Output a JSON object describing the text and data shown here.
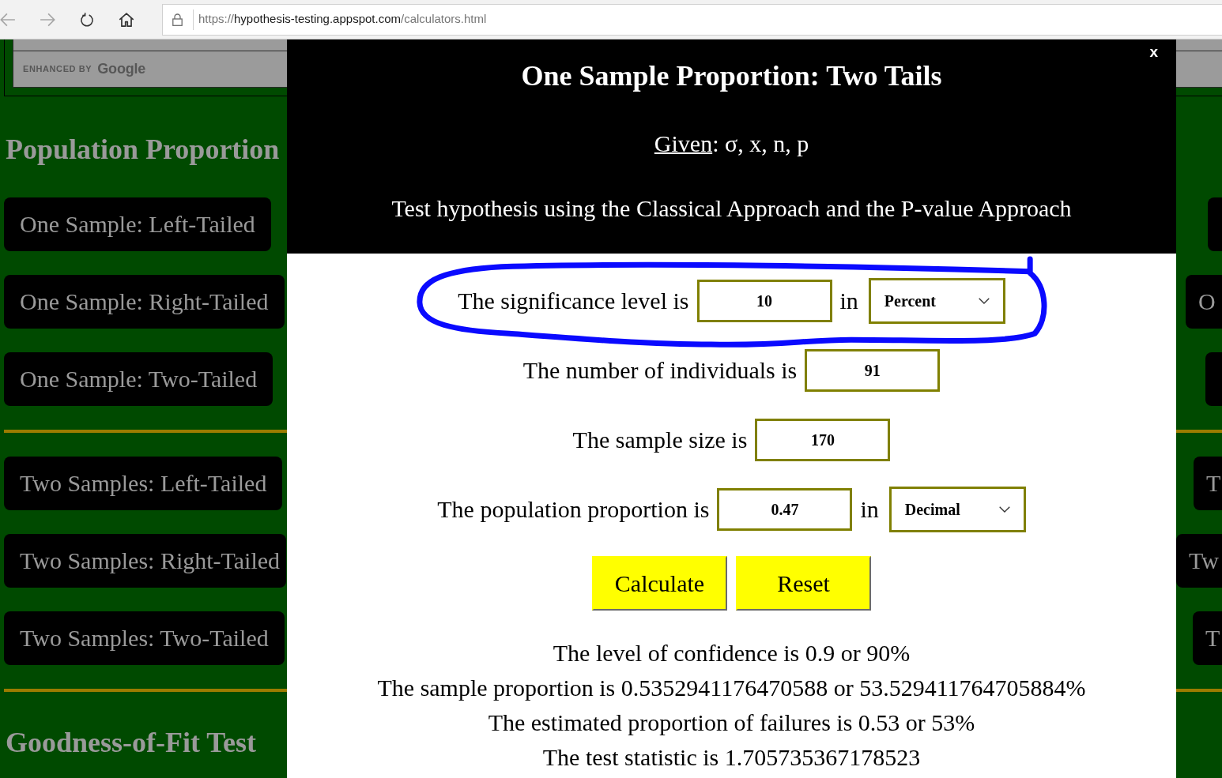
{
  "browser": {
    "nav_buttons": [
      {
        "kind": "back",
        "disabled": true
      },
      {
        "kind": "forward",
        "disabled": true
      },
      {
        "kind": "reload",
        "disabled": false
      },
      {
        "kind": "home",
        "disabled": false
      }
    ],
    "address": {
      "scheme": "https://",
      "host": "hypothesis-testing.appspot.com",
      "path": "/calculators.html"
    }
  },
  "search": {
    "branding_prefix": "ENHANCED BY",
    "branding_name": "Google"
  },
  "left_column": [
    {
      "kind": "heading",
      "text": "Population Proportion"
    },
    {
      "kind": "button",
      "label": "One Sample: Left-Tailed"
    },
    {
      "kind": "button",
      "label": "One Sample: Right-Tailed"
    },
    {
      "kind": "button",
      "label": "One Sample: Two-Tailed"
    },
    {
      "kind": "rule"
    },
    {
      "kind": "button",
      "label": "Two Samples: Left-Tailed"
    },
    {
      "kind": "button",
      "label": "Two Samples: Right-Tailed"
    },
    {
      "kind": "button",
      "label": "Two Samples: Two-Tailed"
    },
    {
      "kind": "rule"
    },
    {
      "kind": "heading",
      "text": "Goodness-of-Fit Test"
    }
  ],
  "right_column": [
    {
      "kind": "button"
    },
    {
      "kind": "button",
      "label": "O"
    },
    {
      "kind": "button"
    },
    {
      "kind": "rule"
    },
    {
      "kind": "button",
      "label": "T"
    },
    {
      "kind": "button",
      "label": "Tw"
    },
    {
      "kind": "button",
      "label": "T"
    },
    {
      "kind": "rule"
    }
  ],
  "dialog": {
    "close": "x",
    "title": "One Sample Proportion: Two Tails",
    "given": {
      "term": "Given",
      "rest": ": σ, x, n, p"
    },
    "instruction": "Test hypothesis using the Classical Approach and the P-value Approach",
    "fields": [
      {
        "label": "The significance level is",
        "value": "10",
        "connector": "in",
        "unit": "Percent",
        "circled": true
      },
      {
        "label": "The number of individuals is",
        "value": "91",
        "circled": false
      },
      {
        "label": "The sample size is",
        "value": "170",
        "circled": false
      },
      {
        "label": "The population proportion is",
        "value": "0.47",
        "connector": "in",
        "unit": "Decimal",
        "circled": false
      }
    ],
    "buttons": [
      "Calculate",
      "Reset"
    ],
    "results": [
      "The level of confidence is 0.9 or 90%",
      "The sample proportion is 0.5352941176470588 or 53.529411764705884%",
      "The estimated proportion of failures is 0.53 or 53%",
      "The test statistic is 1.705735367178523"
    ]
  }
}
